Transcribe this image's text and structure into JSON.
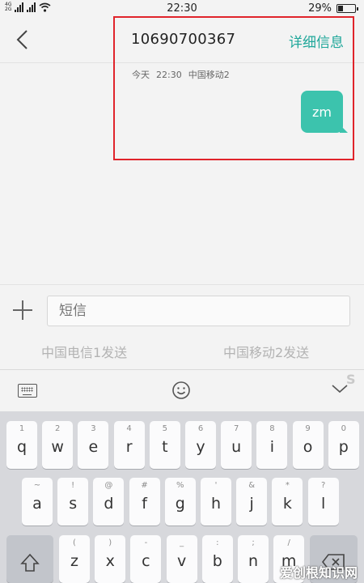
{
  "status_bar": {
    "network_top": "4G",
    "network_bottom": "2G",
    "time": "22:30",
    "battery_text": "29%",
    "battery_level": 0.29
  },
  "header": {
    "contact": "10690700367",
    "details": "详细信息"
  },
  "conversation": {
    "meta_date": "今天",
    "meta_time": "22:30",
    "meta_sim": "中国移动2",
    "message_text": "zm",
    "bubble_color": "#3cc3ad",
    "highlight_color": "#e0242b"
  },
  "compose": {
    "placeholder": "短信",
    "send_sim1": "中国电信1发送",
    "send_sim2": "中国移动2发送"
  },
  "keyboard": {
    "row1": [
      {
        "h": "1",
        "k": "q"
      },
      {
        "h": "2",
        "k": "w"
      },
      {
        "h": "3",
        "k": "e"
      },
      {
        "h": "4",
        "k": "r"
      },
      {
        "h": "5",
        "k": "t"
      },
      {
        "h": "6",
        "k": "y"
      },
      {
        "h": "7",
        "k": "u"
      },
      {
        "h": "8",
        "k": "i"
      },
      {
        "h": "9",
        "k": "o"
      },
      {
        "h": "0",
        "k": "p"
      }
    ],
    "row2": [
      {
        "h": "~",
        "k": "a"
      },
      {
        "h": "!",
        "k": "s"
      },
      {
        "h": "@",
        "k": "d"
      },
      {
        "h": "#",
        "k": "f"
      },
      {
        "h": "%",
        "k": "g"
      },
      {
        "h": "'",
        "k": "h"
      },
      {
        "h": "&",
        "k": "j"
      },
      {
        "h": "*",
        "k": "k"
      },
      {
        "h": "?",
        "k": "l"
      }
    ],
    "row3": [
      {
        "h": "(",
        "k": "z"
      },
      {
        "h": ")",
        "k": "x"
      },
      {
        "h": "-",
        "k": "c"
      },
      {
        "h": "_",
        "k": "v"
      },
      {
        "h": ":",
        "k": "b"
      },
      {
        "h": ";",
        "k": "n"
      },
      {
        "h": "/",
        "k": "m"
      }
    ]
  },
  "watermark": "爱创根知识网"
}
